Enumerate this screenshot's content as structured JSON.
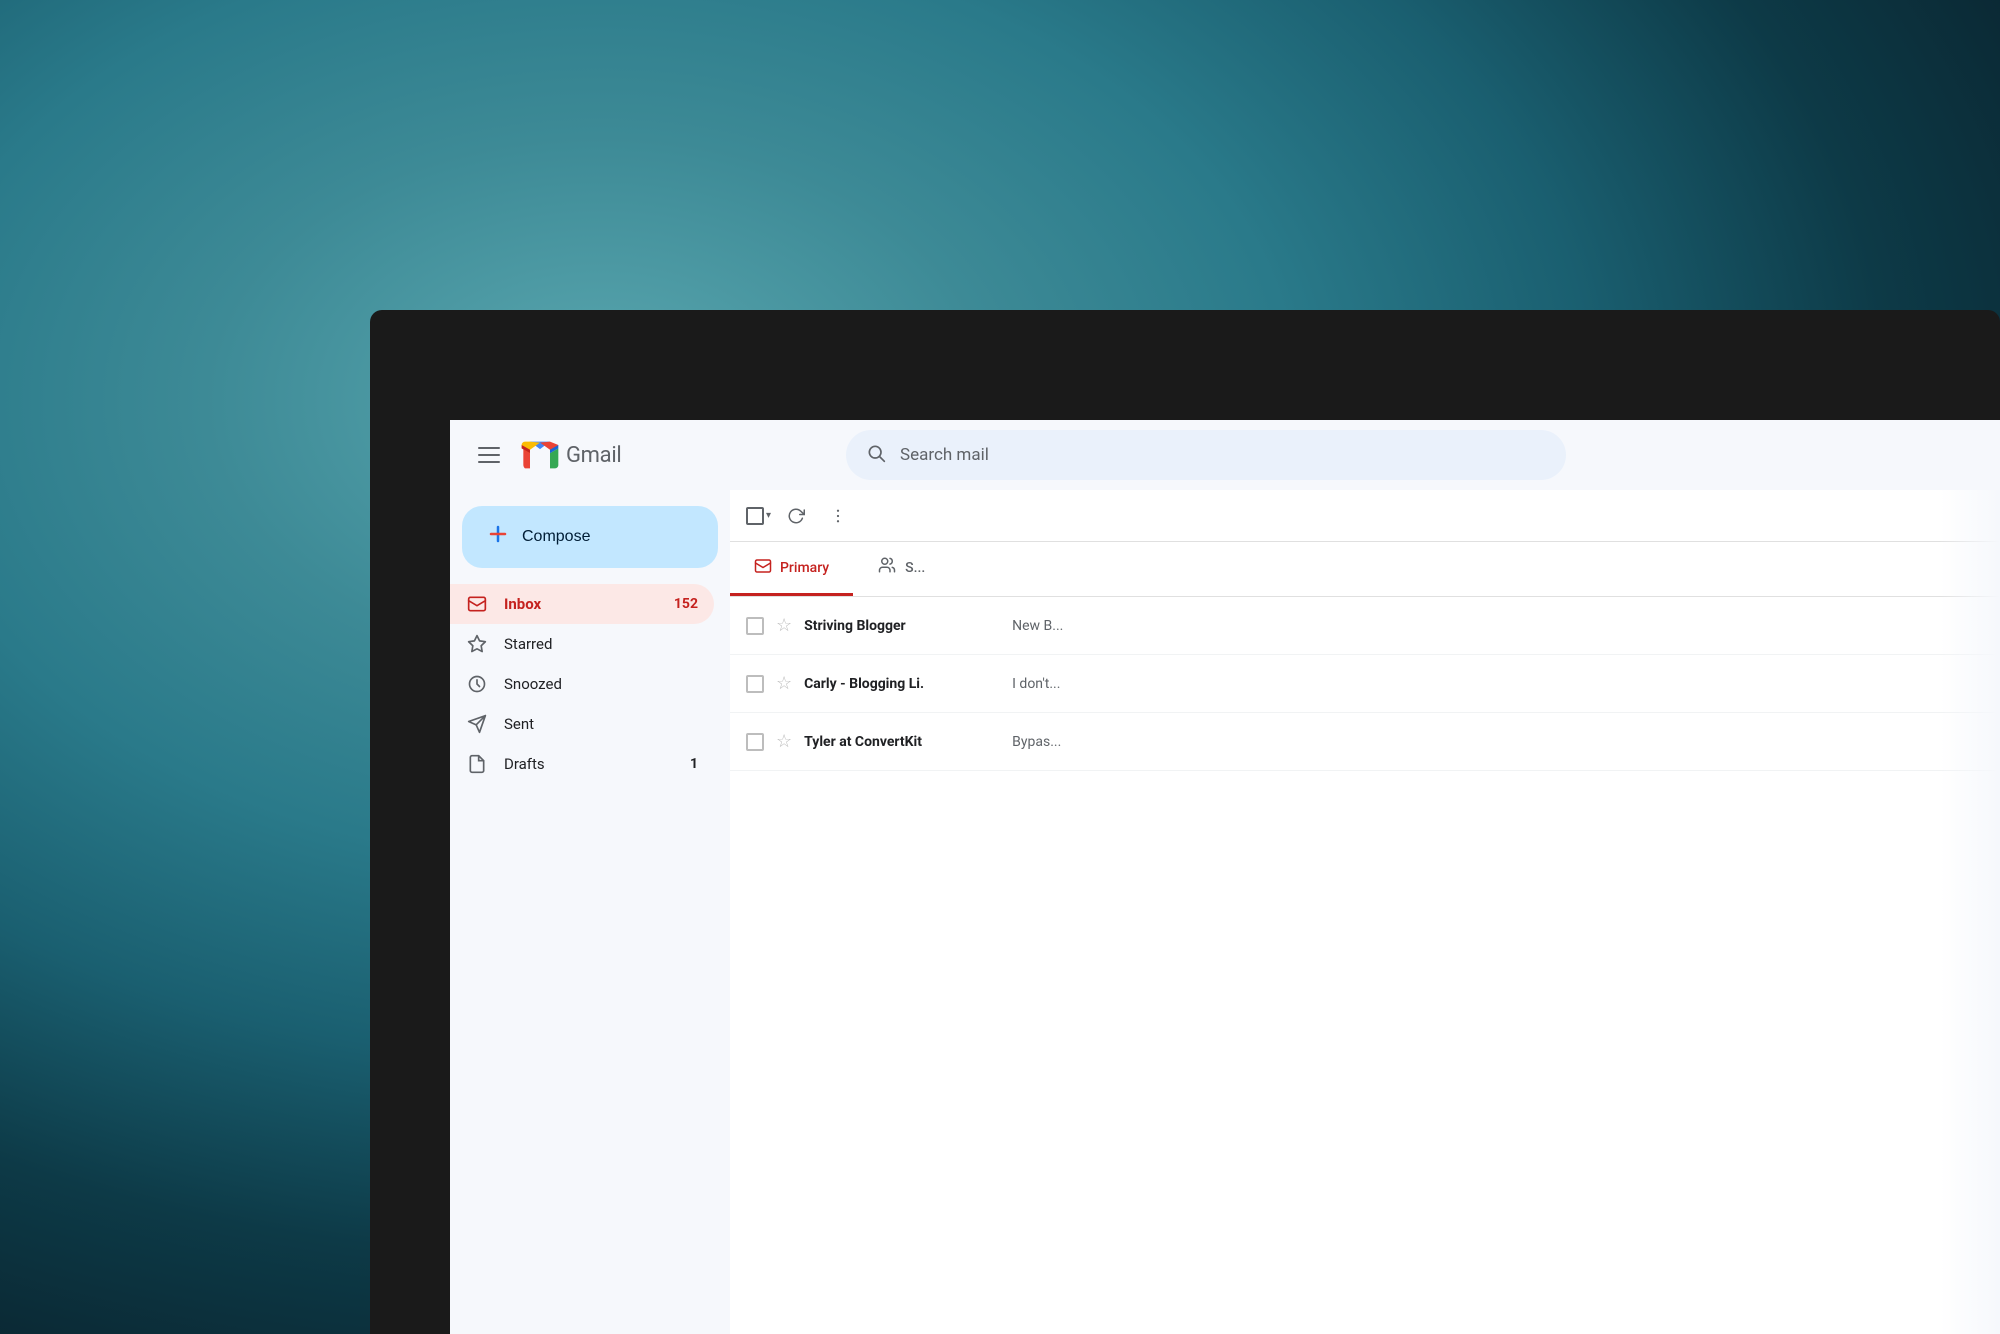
{
  "background": {
    "description": "Blurred ocean/water background with dark blue-teal tones"
  },
  "header": {
    "menu_icon_label": "Main menu",
    "logo_alt": "Gmail logo",
    "app_name": "Gmail",
    "search_placeholder": "Search mail"
  },
  "sidebar": {
    "compose_label": "Compose",
    "nav_items": [
      {
        "id": "inbox",
        "label": "Inbox",
        "count": "152",
        "active": true
      },
      {
        "id": "starred",
        "label": "Starred",
        "count": "",
        "active": false
      },
      {
        "id": "snoozed",
        "label": "Snoozed",
        "count": "",
        "active": false
      },
      {
        "id": "sent",
        "label": "Sent",
        "count": "",
        "active": false
      },
      {
        "id": "drafts",
        "label": "Drafts",
        "count": "1",
        "active": false
      }
    ]
  },
  "toolbar": {
    "select_all_label": "Select",
    "refresh_label": "Refresh",
    "more_label": "More"
  },
  "tabs": [
    {
      "id": "primary",
      "label": "Primary",
      "active": true,
      "icon": "inbox-tab-icon"
    },
    {
      "id": "social",
      "label": "S...",
      "active": false,
      "icon": "people-tab-icon"
    }
  ],
  "emails": [
    {
      "sender": "Striving Blogger",
      "preview": "New B...",
      "unread": true
    },
    {
      "sender": "Carly - Blogging Li.",
      "preview": "I don't...",
      "unread": true
    },
    {
      "sender": "Tyler at ConvertKit",
      "preview": "Bypas...",
      "unread": true
    }
  ],
  "colors": {
    "gmail_red": "#EA4335",
    "primary_tab_underline": "#c5221f",
    "inbox_active_bg": "#fce8e6",
    "inbox_count_color": "#c5221f",
    "inbox_label_color": "#c5221f",
    "compose_bg": "#c2e7ff",
    "search_bg": "#eaf1fb"
  }
}
